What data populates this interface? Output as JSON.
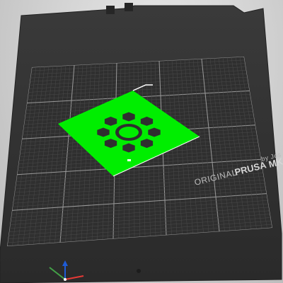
{
  "viewport": {
    "background": "#cfcfcf"
  },
  "bed": {
    "surface_color": "#2f2f2f",
    "grid_minor_color": "#4a4a4a",
    "grid_major_color": "#9a9a9a",
    "label_prefix": "ORIGINAL",
    "label_brand": "PRUSA",
    "label_model": "MK",
    "label_byline": "by Jos"
  },
  "model": {
    "color": "#00ee00",
    "shape": "flower-cutout-plate",
    "cutouts": 9
  },
  "axes": {
    "x_color": "#e53935",
    "y_color": "#43a047",
    "z_color": "#1e5bd6"
  }
}
